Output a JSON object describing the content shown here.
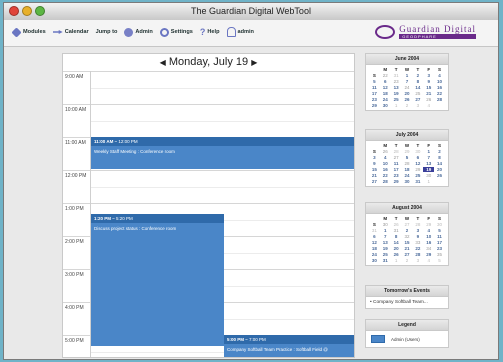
{
  "window": {
    "title": "The Guardian Digital WebTool"
  },
  "nav": {
    "items": [
      {
        "label": "Modules",
        "icon": "modules-icon"
      },
      {
        "label": "Calendar",
        "icon": "calendar-icon"
      },
      {
        "label": "Jump to",
        "icon": "jump-arrow-icon"
      },
      {
        "label": "Admin",
        "icon": "admin-icon"
      },
      {
        "label": "Settings",
        "icon": "settings-icon"
      },
      {
        "label": "Help",
        "icon": "help-icon"
      },
      {
        "label": "admin",
        "icon": "user-icon"
      }
    ]
  },
  "logo": {
    "brand": "Guardian Digital",
    "sub": "GEODPHARE"
  },
  "day": {
    "title": "Monday, July 19",
    "prev": "◀",
    "next": "▶",
    "hours": [
      "9:00 AM",
      "10:00 AM",
      "11:00 AM",
      "12:00 PM",
      "1:00 PM",
      "2:00 PM",
      "3:00 PM",
      "4:00 PM",
      "5:00 PM"
    ]
  },
  "events": [
    {
      "start": "11:00 AM",
      "end": "12:00 PM",
      "title": "Weekly Staff Meeting : Conference room"
    },
    {
      "start": "1:20 PM",
      "end": "5:20 PM",
      "title": "Discuss project status : Conference room"
    },
    {
      "start": "5:00 PM",
      "end": "7:00 PM",
      "title": "Company Softball Team Practice : Softball Field @"
    }
  ],
  "months": [
    {
      "name": "June 2004",
      "dow": [
        "",
        "M",
        "T",
        "W",
        "T",
        "F",
        "S",
        "S"
      ],
      "weeks": [
        [
          "22",
          "31",
          "1",
          "2",
          "3",
          "4",
          "5",
          "6"
        ],
        [
          "23",
          "7",
          "8",
          "9",
          "10",
          "11",
          "12",
          "13"
        ],
        [
          "24",
          "14",
          "15",
          "16",
          "17",
          "18",
          "19",
          "20"
        ],
        [
          "25",
          "21",
          "22",
          "23",
          "24",
          "25",
          "26",
          "27"
        ],
        [
          "26",
          "28",
          "29",
          "30",
          "1",
          "2",
          "3",
          "4"
        ]
      ]
    },
    {
      "name": "July 2004",
      "dow": [
        "",
        "M",
        "T",
        "W",
        "T",
        "F",
        "S",
        "S"
      ],
      "weeks": [
        [
          "26",
          "28",
          "29",
          "30",
          "1",
          "2",
          "3",
          "4"
        ],
        [
          "27",
          "5",
          "6",
          "7",
          "8",
          "9",
          "10",
          "11"
        ],
        [
          "28",
          "12",
          "13",
          "14",
          "15",
          "16",
          "17",
          "18"
        ],
        [
          "29",
          "19",
          "20",
          "21",
          "22",
          "23",
          "24",
          "25"
        ],
        [
          "30",
          "26",
          "27",
          "28",
          "29",
          "30",
          "31",
          "1"
        ]
      ],
      "selected": "19"
    },
    {
      "name": "August 2004",
      "dow": [
        "",
        "M",
        "T",
        "W",
        "T",
        "F",
        "S",
        "S"
      ],
      "weeks": [
        [
          "30",
          "26",
          "27",
          "28",
          "29",
          "30",
          "31",
          "1"
        ],
        [
          "31",
          "2",
          "3",
          "4",
          "5",
          "6",
          "7",
          "8"
        ],
        [
          "32",
          "9",
          "10",
          "11",
          "12",
          "13",
          "14",
          "15"
        ],
        [
          "33",
          "16",
          "17",
          "18",
          "19",
          "20",
          "21",
          "22"
        ],
        [
          "34",
          "23",
          "24",
          "25",
          "26",
          "27",
          "28",
          "29"
        ],
        [
          "35",
          "30",
          "31",
          "1",
          "2",
          "3",
          "4",
          "5"
        ]
      ]
    }
  ],
  "tomorrow": {
    "title": "Tomorrow's Events",
    "items": [
      "• Company Softball Team..."
    ]
  },
  "legend": {
    "title": "Legend",
    "items": [
      {
        "label": "Admin (Users)",
        "color": "#4a86c8"
      }
    ]
  },
  "colors": {
    "event": "#4a86c8",
    "event_header": "#2f6aaa",
    "selected_day": "#3a3f9a",
    "brand": "#6a2a8a"
  }
}
